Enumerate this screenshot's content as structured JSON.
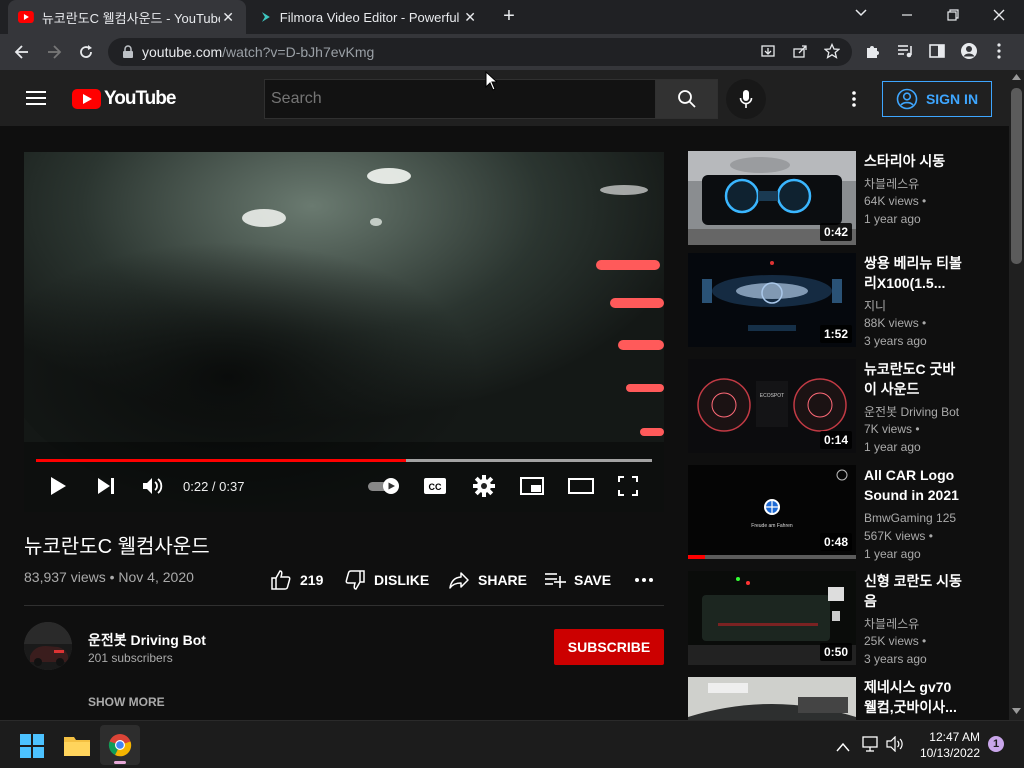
{
  "browser": {
    "tabs": [
      {
        "title": "뉴코란도C 웰컴사운드 - YouTube",
        "active": true
      },
      {
        "title": "Filmora Video Editor - Powerful V",
        "active": false
      }
    ],
    "url_host": "youtube.com",
    "url_path": "/watch?v=D-bJh7evKmg"
  },
  "youtube": {
    "logo_text": "YouTube",
    "search_placeholder": "Search",
    "sign_in": "SIGN IN"
  },
  "player": {
    "time": "0:22 / 0:37",
    "progress": 0.6
  },
  "video": {
    "title": "뉴코란도C 웰컴사운드",
    "stats": "83,937 views • Nov 4, 2020",
    "likes": "219",
    "dislike": "DISLIKE",
    "share": "SHARE",
    "save": "SAVE",
    "channel": "운전봇 Driving Bot",
    "subscribers": "201 subscribers",
    "subscribe": "SUBSCRIBE",
    "show_more": "SHOW MORE"
  },
  "recommendations": [
    {
      "title": "스타리아 시동",
      "channel": "차블레스유",
      "views": "64K views •",
      "age": "1 year ago",
      "duration": "0:42"
    },
    {
      "title": "쌍용 베리뉴 티볼리X100(1.5...",
      "channel": "지니",
      "views": "88K views •",
      "age": "3 years ago",
      "duration": "1:52"
    },
    {
      "title": "뉴코란도C 굿바이 사운드",
      "channel": "운전봇 Driving Bot",
      "views": "7K views •",
      "age": "1 year ago",
      "duration": "0:14"
    },
    {
      "title": "All CAR Logo Sound in 2021",
      "channel": "BmwGaming 125",
      "views": "567K views •",
      "age": "1 year ago",
      "duration": "0:48",
      "watched": 0.1
    },
    {
      "title": "신형 코란도 시동음",
      "channel": "차블레스유",
      "views": "25K views •",
      "age": "3 years ago",
      "duration": "0:50"
    },
    {
      "title": "제네시스 gv70 웰컴,굿바이사...",
      "channel": "",
      "views": "",
      "age": "",
      "duration": ""
    }
  ],
  "thumbnail_text": {
    "bmw_caption": "Freude am Fahren",
    "dash_label": "ECOSPOT"
  },
  "taskbar": {
    "time": "12:47 AM",
    "date": "10/13/2022",
    "notifications": "1"
  },
  "colors": {
    "accent_red": "#cc0000",
    "link_blue": "#3ea6ff"
  }
}
